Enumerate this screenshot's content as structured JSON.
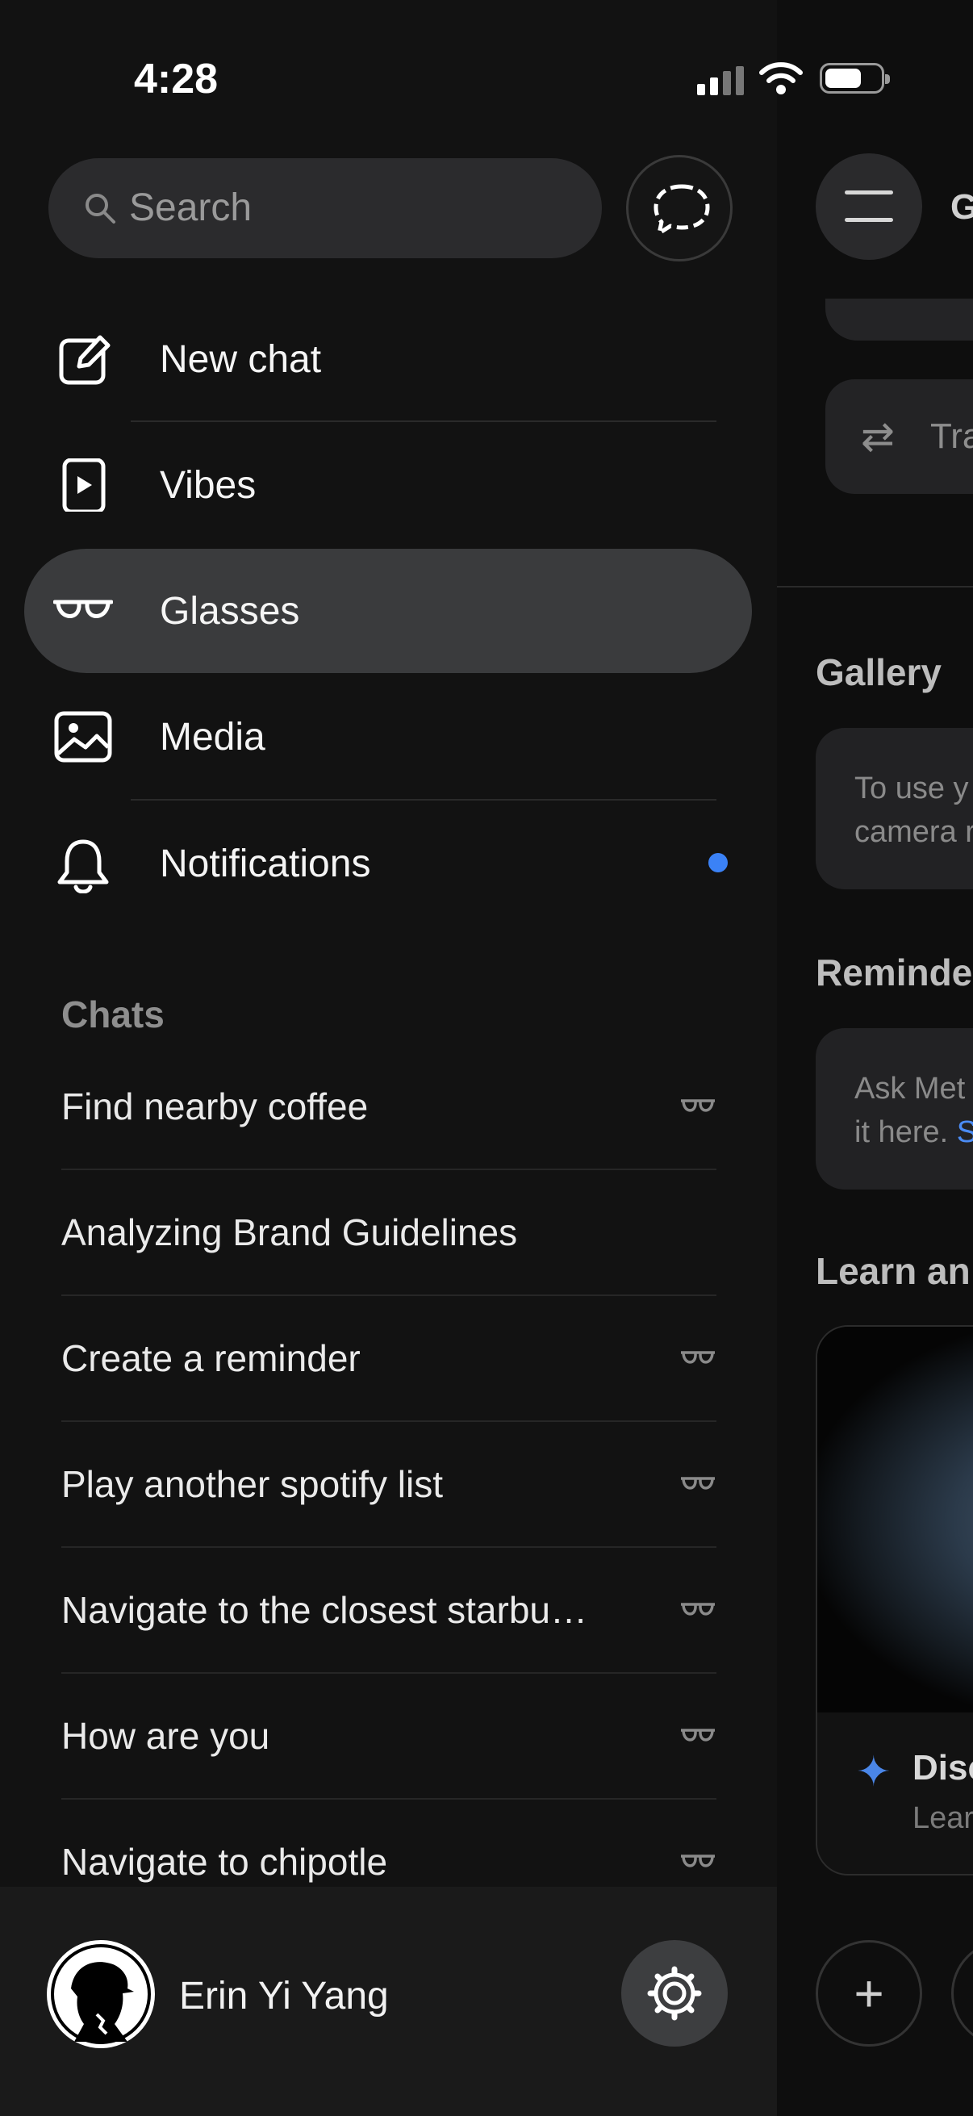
{
  "status_bar": {
    "time": "4:28"
  },
  "search": {
    "placeholder": "Search"
  },
  "nav": {
    "items": [
      {
        "label": "New chat",
        "icon": "edit-icon"
      },
      {
        "label": "Vibes",
        "icon": "play-icon"
      },
      {
        "label": "Glasses",
        "icon": "glasses-icon",
        "active": true
      },
      {
        "label": "Media",
        "icon": "image-icon"
      },
      {
        "label": "Notifications",
        "icon": "bell-icon",
        "badge": "dot"
      }
    ]
  },
  "chats": {
    "heading": "Chats",
    "items": [
      {
        "label": "Find nearby coffee",
        "glasses": true
      },
      {
        "label": "Analyzing Brand Guidelines",
        "glasses": false
      },
      {
        "label": "Create a reminder",
        "glasses": true
      },
      {
        "label": "Play another spotify list",
        "glasses": true
      },
      {
        "label": "Navigate to the closest starbu…",
        "glasses": true
      },
      {
        "label": "How are you",
        "glasses": true
      },
      {
        "label": "Navigate to chipotle",
        "glasses": true
      }
    ]
  },
  "user": {
    "name": "Erin Yi Yang"
  },
  "behind": {
    "title": "G",
    "translate": "Tra",
    "gallery_heading": "Gallery",
    "gallery_text_1": "To use y",
    "gallery_text_2": "camera r",
    "reminders_heading": "Reminde",
    "reminders_text_1": "Ask Met",
    "reminders_text_2": "it here.",
    "reminders_link": "S",
    "learn_heading": "Learn an",
    "card_title": "Disc",
    "card_sub": "Lear"
  },
  "colors": {
    "accent": "#3b82f6",
    "background": "#121212",
    "active_item": "#3a3b3d"
  }
}
